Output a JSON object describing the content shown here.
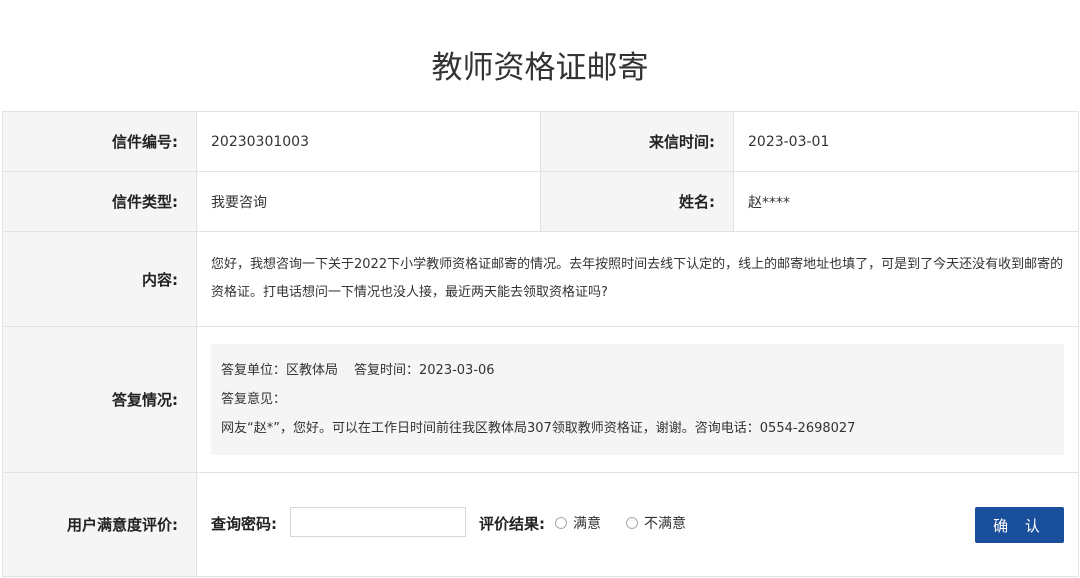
{
  "page": {
    "title": "教师资格证邮寄"
  },
  "letter": {
    "number_label": "信件编号:",
    "number": "20230301003",
    "date_label": "来信时间:",
    "date": "2023-03-01",
    "type_label": "信件类型:",
    "type": "我要咨询",
    "name_label": "姓名:",
    "name": "赵****",
    "content_label": "内容:",
    "content": "您好，我想咨询一下关于2022下小学教师资格证邮寄的情况。去年按照时间去线下认定的，线上的邮寄地址也填了，可是到了今天还没有收到邮寄的资格证。打电话想问一下情况也没人接，最近两天能去领取资格证吗?"
  },
  "reply": {
    "label": "答复情况:",
    "unit": "答复单位：区教体局",
    "time": "答复时间：2023-03-06",
    "opinion_label": "答复意见：",
    "opinion": "网友“赵*”，您好。可以在工作日时间前往我区教体局307领取教师资格证，谢谢。咨询电话：0554-2698027"
  },
  "evaluation": {
    "label": "用户满意度评价:",
    "password_label": "查询密码:",
    "password_value": "",
    "result_label": "评价结果:",
    "option_satisfied": "满意",
    "option_unsatisfied": "不满意",
    "confirm": "确 认"
  }
}
